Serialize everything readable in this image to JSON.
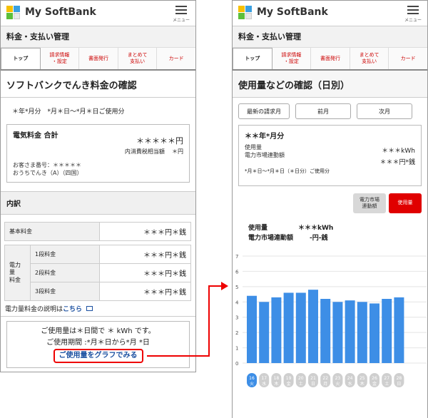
{
  "app": {
    "name": "My SoftBank",
    "menu_label": "メニュー"
  },
  "colors": {
    "accent_red": "#e00000",
    "bar_blue": "#3d8ee6",
    "link_blue": "#1a4fa0",
    "logo": [
      "#f6c000",
      "#3aa0e0",
      "#5cbf3a",
      "#e8e8e8"
    ]
  },
  "left": {
    "section_title": "料金・支払い管理",
    "tabs": [
      "トップ",
      "請求情報\n・設定",
      "書面発行",
      "まとめて\n支払い",
      "カード"
    ],
    "heading": "ソフトバンクでんき料金の確認",
    "period": "＊年*月分　*月＊日～*月＊日ご使用分",
    "bill": {
      "label": "電気料金 合計",
      "amount": "＊＊＊＊＊円",
      "tax_label": "内消費税相当額",
      "tax_value": "＊円",
      "customer_no": "お客さま番号：＊＊＊＊＊",
      "plan": "おうちでんき（A）（四国）"
    },
    "breakdown": {
      "title": "内訳",
      "basic_label": "基本料金",
      "basic_value": "＊＊＊円＊銭",
      "energy_label": "電力量\n料金",
      "tiers": [
        {
          "label": "1段料金",
          "value": "＊＊＊円＊銭"
        },
        {
          "label": "2段料金",
          "value": "＊＊＊円＊銭"
        },
        {
          "label": "3段料金",
          "value": "＊＊＊円＊銭"
        }
      ],
      "explain_text": "電力量料金の説明は",
      "explain_link": "こちら"
    },
    "notice": {
      "usage": "ご使用量は＊日間で ＊ kWh です。",
      "period": "ご使用期間 :*月＊日から*月 *日",
      "graph_link": "ご使用量をグラフでみる"
    }
  },
  "right": {
    "section_title": "料金・支払い管理",
    "tabs": [
      "トップ",
      "請求情報\n・設定",
      "書面発行",
      "まとめて\n支払い",
      "カード"
    ],
    "heading": "使用量などの確認（日別）",
    "nav": {
      "latest": "最新の請求月",
      "prev": "前月",
      "next": "次月"
    },
    "month_card": {
      "month": "＊＊年*月分",
      "usage_label": "使用量",
      "usage_value": "＊＊＊kWh",
      "linked_label": "電力市場連動額",
      "linked_value": "＊＊＊円*銭",
      "range": "*月＊日～*月＊日（＊日分）ご使用分"
    },
    "toggles": {
      "market": "電力市場\n連動額",
      "usage": "使用量"
    },
    "summary": {
      "usage_label": "使用量",
      "usage_value": "＊＊＊kWh",
      "linked_label": "電力市場連動額",
      "linked_value": "-円-銭"
    }
  },
  "chart_data": {
    "type": "bar",
    "ylim": [
      0,
      7
    ],
    "yticks": [
      "7",
      "6",
      "5",
      "4",
      "3",
      "2",
      "1",
      "0"
    ],
    "categories": [
      "16",
      "17",
      "18",
      "19",
      "20",
      "21",
      "22",
      "23",
      "24",
      "25",
      "26",
      "27",
      "28"
    ],
    "weekdays": [
      "火",
      "水",
      "木",
      "金",
      "土",
      "日",
      "月",
      "火",
      "水",
      "木",
      "金",
      "土",
      "日"
    ],
    "selected_index": 0,
    "grid": true,
    "series": [
      {
        "values": [
          4.4,
          4.0,
          4.3,
          4.6,
          4.6,
          4.8,
          4.2,
          4.0,
          4.1,
          4.0,
          3.9,
          4.2,
          4.3
        ]
      }
    ]
  }
}
